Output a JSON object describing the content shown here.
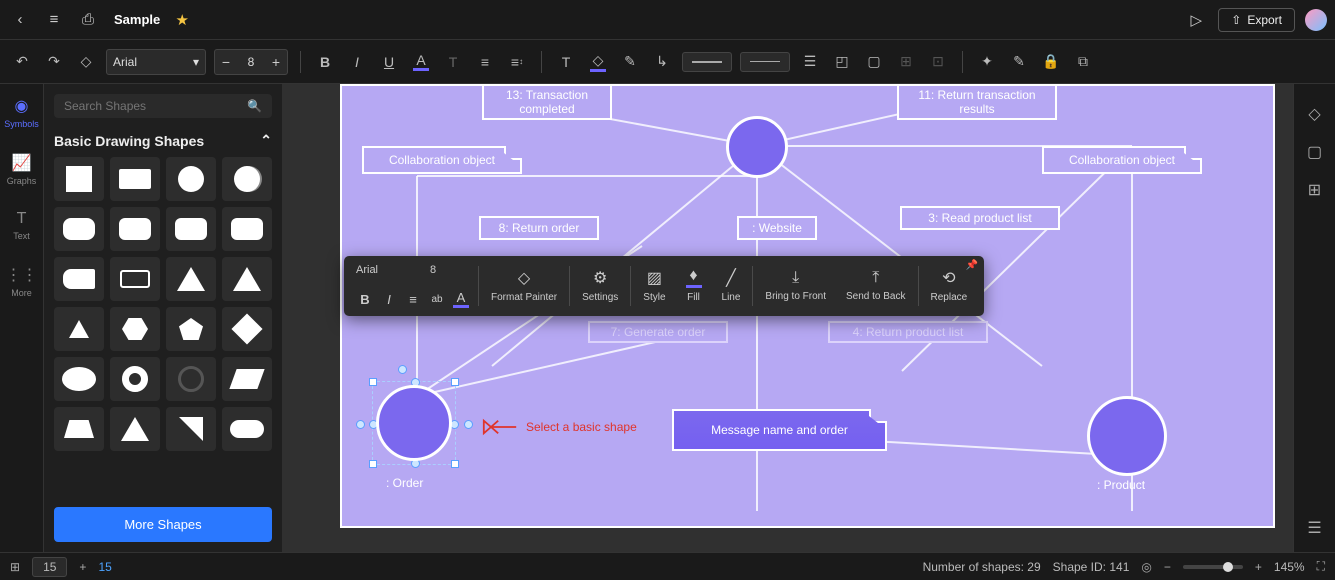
{
  "header": {
    "title": "Sample",
    "export_label": "Export"
  },
  "toolbar": {
    "font": "Arial",
    "font_size": "8"
  },
  "rail": {
    "items": [
      {
        "label": "Symbols"
      },
      {
        "label": "Graphs"
      },
      {
        "label": "Text"
      },
      {
        "label": "More"
      }
    ]
  },
  "left_panel": {
    "search_placeholder": "Search Shapes",
    "section_title": "Basic Drawing Shapes",
    "more_btn": "More Shapes"
  },
  "ctx_toolbar": {
    "font": "Arial",
    "size": "8",
    "items": [
      "Format Painter",
      "Settings",
      "Style",
      "Fill",
      "Line",
      "Bring to Front",
      "Send to Back",
      "Replace"
    ]
  },
  "diagram": {
    "nodes": {
      "n13": "13: Transaction completed",
      "n11": "11: Return transaction results",
      "collab_l": "Collaboration object",
      "collab_r": "Collaboration object",
      "n8": "8: Return order",
      "website": ": Website",
      "n3": "3: Read product list",
      "n7": "7: Generate order",
      "n4": "4: Return product list",
      "msg": "Message name and order",
      "order": ": Order",
      "product": ": Product"
    }
  },
  "annotation": {
    "text": "Select a basic shape"
  },
  "status": {
    "grid1": "15",
    "grid2": "15",
    "shapes_count": "Number of shapes: 29",
    "shape_id": "Shape ID: 141",
    "zoom": "145%"
  }
}
